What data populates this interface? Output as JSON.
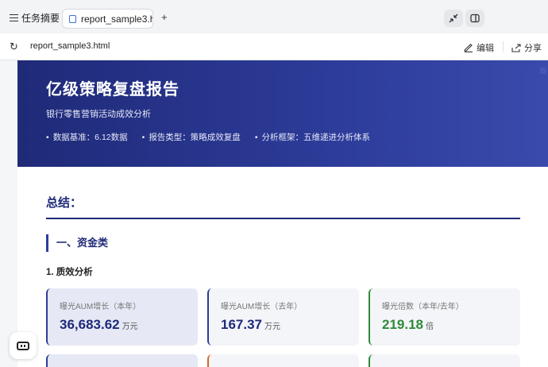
{
  "tabbar": {
    "tasks_label": "任务摘要",
    "tab_title": "report_sample3.ht...",
    "new_tab": "+"
  },
  "address": {
    "url": "report_sample3.html",
    "edit_label": "编辑",
    "share_label": "分享"
  },
  "hero": {
    "title": "亿级策略复盘报告",
    "subtitle": "银行零售营销活动成效分析",
    "meta": [
      "数据基准：6.12数据",
      "报告类型：策略成效复盘",
      "分析框架：五维递进分析体系"
    ]
  },
  "summary": {
    "title": "总结："
  },
  "section": {
    "title": "一、资金类",
    "subtitle": "1. 质效分析"
  },
  "cards": [
    {
      "label": "曝光AUM增长（本年）",
      "value": "36,683.62",
      "unit": "万元",
      "accent": "#2d3c9a"
    },
    {
      "label": "曝光AUM增长（去年）",
      "value": "167.37",
      "unit": "万元",
      "accent": "#2d3c9a"
    },
    {
      "label": "曝光倍数（本年/去年）",
      "value": "219.18",
      "unit": "倍",
      "accent": "#2e8b3a"
    }
  ],
  "colors": {
    "brand": "#1f2a78",
    "accent_green": "#2e8b3a",
    "accent_orange": "#d9662a"
  }
}
